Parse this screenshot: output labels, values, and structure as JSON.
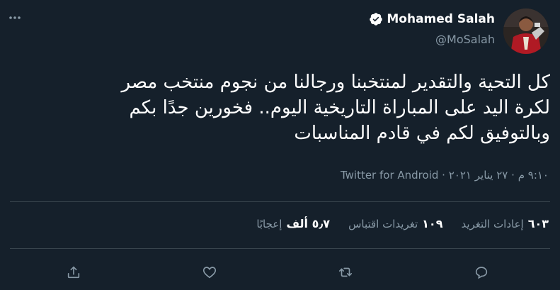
{
  "menu": {
    "icon": "more-icon"
  },
  "author": {
    "name": "Mohamed Salah",
    "handle": "@MoSalah",
    "verified_icon": "verified-badge-icon",
    "avatar_icon": "avatar-photo"
  },
  "tweet": {
    "lines": [
      "كل التحية والتقدير لمنتخبنا ورجالنا من نجوم منتخب مصر",
      "لكرة اليد على المباراة التاريخية اليوم.. فخورين جدًا بكم",
      "وبالتوفيق لكم في قادم المناسبات"
    ]
  },
  "meta": {
    "time": "٩:١٠ م",
    "date": "٢٧ يناير ٢٠٢١",
    "separator": "·",
    "source": "Twitter for Android"
  },
  "stats": {
    "retweets": {
      "value": "٦٠٣",
      "label": "إعادات التغريد"
    },
    "quotes": {
      "value": "١٠٩",
      "label": "تغريدات اقتباس"
    },
    "likes": {
      "value": "٥٫٧ ألف",
      "label": "إعجابًا"
    }
  },
  "actions": [
    "reply-icon",
    "retweet-icon",
    "like-icon",
    "share-icon"
  ],
  "colors": {
    "background": "#15202b",
    "text": "#ffffff",
    "secondary": "#8899a6",
    "divider": "#38444d"
  }
}
